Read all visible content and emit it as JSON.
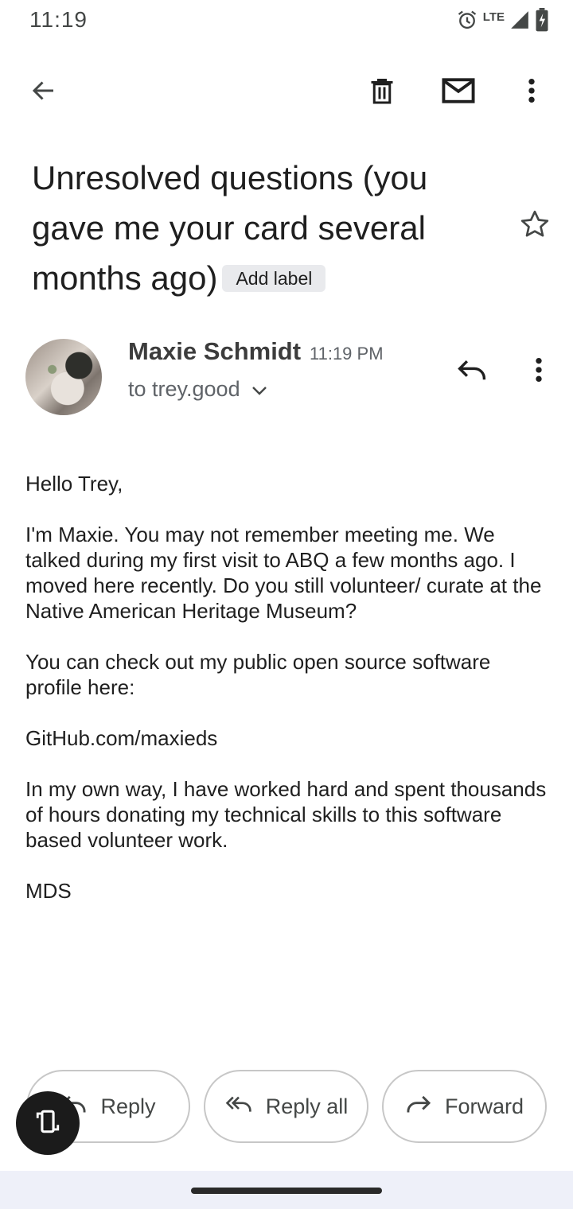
{
  "status_bar": {
    "time": "11:19",
    "network": "LTE",
    "icons": [
      "alarm-icon",
      "signal-icon",
      "battery-charging-icon"
    ]
  },
  "toolbar": {
    "icons": [
      "back-arrow-icon",
      "delete-icon",
      "mark-unread-icon",
      "more-vert-icon"
    ]
  },
  "email": {
    "subject": "Unresolved questions (you gave me your card several months ago)",
    "label_chip": "Add label",
    "sender_name": "Maxie Schmidt",
    "time": "11:19 PM",
    "recipient": "to trey.good",
    "body": [
      "Hello Trey,",
      "I'm Maxie. You may not remember meeting me. We talked during my first visit to ABQ a few months ago. I moved here recently. Do you still volunteer/ curate at the Native American Heritage Museum?",
      "You can check out my public open source software profile here:",
      "GitHub.com/maxieds",
      "In my own way, I have worked hard and spent thousands of hours donating my technical skills to this software based volunteer work.",
      "MDS"
    ]
  },
  "actions": {
    "reply": "Reply",
    "reply_all": "Reply all",
    "forward": "Forward"
  },
  "colors": {
    "text": "#1f1f1f",
    "secondary": "#5f6368",
    "chip_bg": "#e9eaed",
    "nav_bg": "#eef0f9",
    "fab_bg": "#1b1b1b"
  }
}
